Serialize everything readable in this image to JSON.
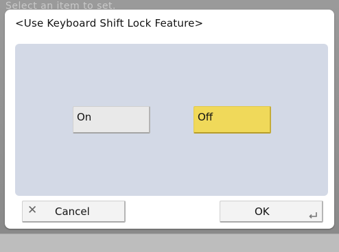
{
  "background": {
    "title": "Select an item to set."
  },
  "dialog": {
    "title": "<Use Keyboard Shift Lock Feature>",
    "options": [
      {
        "label": "On",
        "selected": false
      },
      {
        "label": "Off",
        "selected": true
      }
    ],
    "cancel_label": "Cancel",
    "ok_label": "OK"
  },
  "colors": {
    "selected": "#f0d95a",
    "panel": "#d3d9e6",
    "button": "#e9e9e9"
  },
  "icons": {
    "cancel": "close-icon",
    "ok": "enter-return-icon"
  }
}
